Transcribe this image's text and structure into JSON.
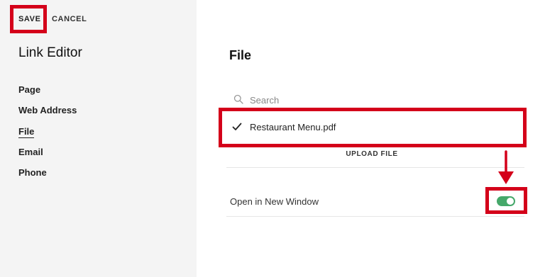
{
  "toolbar": {
    "save_label": "SAVE",
    "cancel_label": "CANCEL"
  },
  "sidebar": {
    "title": "Link Editor",
    "items": [
      {
        "label": "Page",
        "active": false
      },
      {
        "label": "Web Address",
        "active": false
      },
      {
        "label": "File",
        "active": true
      },
      {
        "label": "Email",
        "active": false
      },
      {
        "label": "Phone",
        "active": false
      }
    ]
  },
  "main": {
    "title": "File",
    "search": {
      "placeholder": "Search",
      "value": "",
      "icon": "search-icon"
    },
    "selected_file": {
      "name": "Restaurant Menu.pdf",
      "checked": true,
      "icon": "check-icon"
    },
    "upload_label": "UPLOAD FILE",
    "open_new_window": {
      "label": "Open in New Window",
      "enabled": true
    }
  },
  "colors": {
    "sidebar_bg": "#f4f4f4",
    "toggle_on": "#45a86a",
    "annotation": "#d4001a"
  }
}
